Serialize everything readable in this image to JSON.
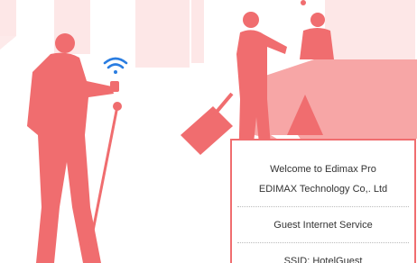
{
  "colors": {
    "primary": "#f06d6f",
    "light": "#f9b8b8",
    "pale": "#fde3e3"
  },
  "card": {
    "welcome": "Welcome to Edimax Pro",
    "company": "EDIMAX Technology Co,. Ltd",
    "service": "Guest Internet Service",
    "ssid": "SSID: HotelGuest"
  },
  "icons": [
    "wifi-icon"
  ]
}
